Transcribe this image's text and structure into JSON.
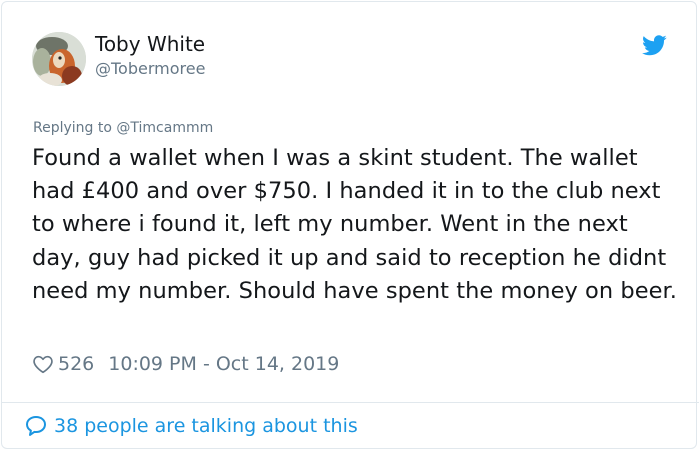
{
  "user": {
    "display_name": "Toby White",
    "handle": "@Tobermoree",
    "avatar": "profile-avatar-illustration"
  },
  "brand": {
    "icon": "twitter-bird-icon",
    "color": "#1da1f2"
  },
  "tweet": {
    "reply_prefix": "Replying to ",
    "reply_to": "@Timcammm",
    "text": "Found a wallet when I was a skint student. The wallet had £400 and over $750. I handed it in to the club next to where i found it, left my number. Went in the next day, guy had picked it up and said to reception he didnt need my number. Should have spent the money on beer."
  },
  "meta": {
    "like_icon": "heart-icon",
    "likes": "526",
    "timestamp": "10:09 PM - Oct 14, 2019"
  },
  "footer": {
    "icon": "speech-bubble-icon",
    "talking_text": "38 people are talking about this"
  },
  "colors": {
    "text": "#14171a",
    "secondary": "#657786",
    "link": "#1b95e0",
    "border": "#e1e8ed"
  }
}
